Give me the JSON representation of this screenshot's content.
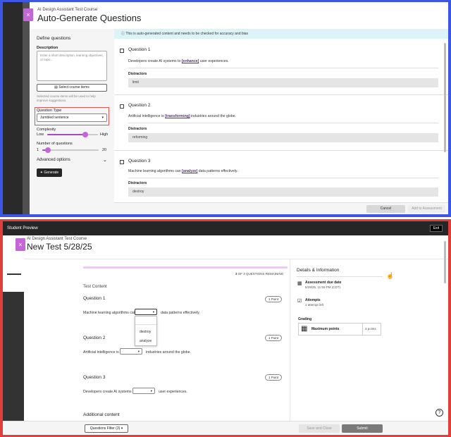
{
  "generator": {
    "course_name": "AI Design Assistant Test Course",
    "title": "Auto-Generate Questions",
    "close_glyph": "×",
    "left_panel": {
      "heading": "Define questions",
      "description_label": "Description",
      "description_placeholder": "Enter a short description, learning objectives, or topic...",
      "select_course_items": "Select course items",
      "selected_note": "Selected course items will be used to help improve suggestions.",
      "question_type_label": "Question Type",
      "question_type_value": "Jumbled sentence",
      "complexity_label": "Complexity",
      "complexity_low": "Low",
      "complexity_high": "High",
      "complexity_level": 0.75,
      "num_questions_label": "Number of questions",
      "num_min": "1",
      "num_max": "20",
      "num_value": 3,
      "advanced_options": "Advanced options",
      "generate": "Generate"
    },
    "banner": "This is auto-generated content and needs to be checked for accuracy and bias",
    "questions": [
      {
        "title": "Question 1",
        "pre": "Developers create AI systems to ",
        "word": "[enhance]",
        "post": " user experiences.",
        "distractors_label": "Distractors",
        "distractor": "limit"
      },
      {
        "title": "Question 2",
        "pre": "Artificial intelligence is ",
        "word": "[transforming]",
        "post": " industries around the globe.",
        "distractors_label": "Distractors",
        "distractor": "reforming"
      },
      {
        "title": "Question 3",
        "pre": "Machine learning algorithms can ",
        "word": "[analyze]",
        "post": " data patterns effectively.",
        "distractors_label": "Distractors",
        "distractor": "destroy"
      }
    ],
    "cancel": "Cancel",
    "add_to_assessment": "Add to Assessment"
  },
  "preview": {
    "bar_title": "Student Preview",
    "exit": "Exit",
    "course_name": "AI Design Assistant Test Course",
    "test_title": "New Test 5/28/25",
    "close_glyph": "×",
    "progress_count": "3",
    "progress_text": "OF 3 QUESTIONS REMAINING",
    "section_title": "Test Content",
    "questions": [
      {
        "title": "Question 1",
        "points": "1 Point",
        "pre": "Machine learning algorithms can",
        "post": "data patterns effectively."
      },
      {
        "title": "Question 2",
        "points": "1 Point",
        "pre": "Artificial intelligence is",
        "post": "industries around the globe."
      },
      {
        "title": "Question 3",
        "points": "1 Point",
        "pre": "Developers create AI systems to",
        "post": "user experiences."
      }
    ],
    "dropdown_options": [
      "destroy",
      "analyze"
    ],
    "additional_content": "Additional content",
    "details_title": "Details & Information",
    "due_label": "Assessment due date",
    "due_value": "5/29/25, 11:59 PM (CDT)",
    "attempts_label": "Attempts",
    "attempts_value": "1 attempt left",
    "grading_label": "Grading",
    "max_points_label": "Maximum points",
    "max_points_value": "3 points",
    "questions_filter": "Questions Filter (3)",
    "save_close": "Save and Close",
    "submit": "Submit",
    "help_glyph": "?"
  },
  "colors": {
    "top_border": "#3e56e6",
    "bottom_border": "#e03d3d",
    "accent": "#c466d8",
    "highlight_box": "#e05555"
  }
}
